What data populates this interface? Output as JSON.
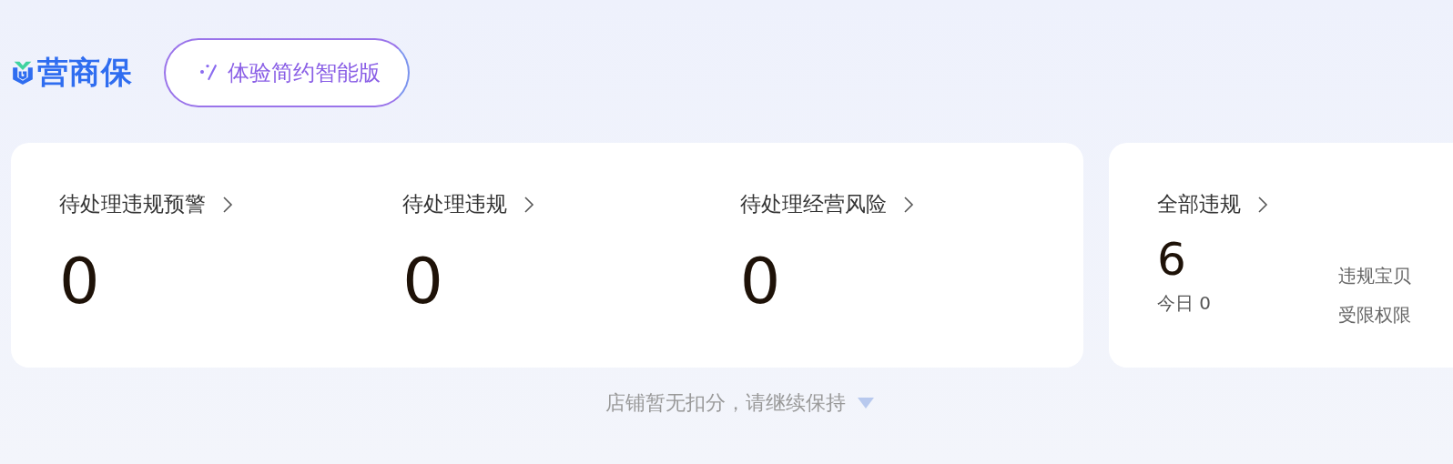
{
  "brand": {
    "name": "营商保"
  },
  "mode_button": {
    "label": "体验简约智能版"
  },
  "pending_stats": [
    {
      "label": "待处理违规预警",
      "value": "0"
    },
    {
      "label": "待处理违规",
      "value": "0"
    },
    {
      "label": "待处理经营风险",
      "value": "0"
    }
  ],
  "all_violations": {
    "label": "全部违规",
    "value": "6",
    "today": "今日 0",
    "links": [
      "违规宝贝",
      "受限权限"
    ]
  },
  "footer": {
    "message": "店铺暂无扣分，请继续保持"
  }
}
